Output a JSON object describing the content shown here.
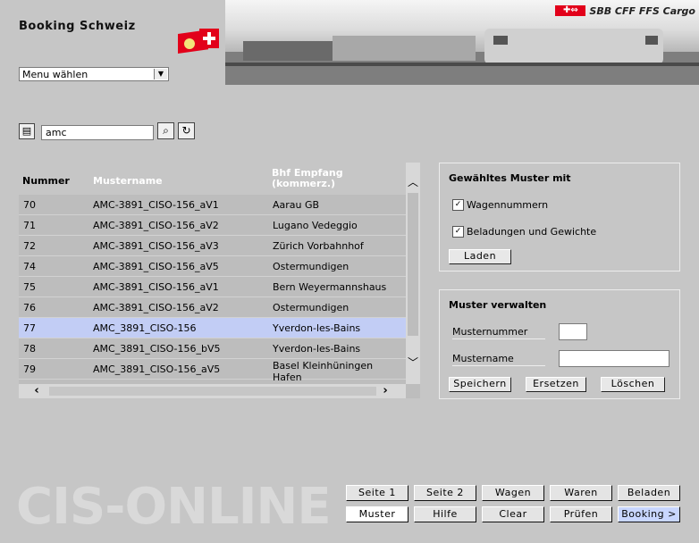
{
  "app": {
    "title": "Booking Schweiz"
  },
  "brand": {
    "mark": "✚⇔",
    "text": "SBB CFF FFS Cargo"
  },
  "menu": {
    "selected": "Menu wählen"
  },
  "search": {
    "value": "amc"
  },
  "table": {
    "headers": {
      "num": "Nummer",
      "name": "Mustername",
      "bhf_line1": "Bhf Empfang",
      "bhf_line2": "(kommerz.)"
    },
    "rows": [
      {
        "num": "70",
        "name": "AMC-3891_CISO-156_aV1",
        "bhf": "Aarau GB",
        "bhf2": ""
      },
      {
        "num": "71",
        "name": "AMC-3891_CISO-156_aV2",
        "bhf": "Lugano Vedeggio",
        "bhf2": ""
      },
      {
        "num": "72",
        "name": "AMC-3891_CISO-156_aV3",
        "bhf": "Zürich Vorbahnhof",
        "bhf2": ""
      },
      {
        "num": "74",
        "name": "AMC-3891_CISO-156_aV5",
        "bhf": "Ostermundigen",
        "bhf2": ""
      },
      {
        "num": "75",
        "name": "AMC-3891_CISO-156_aV1",
        "bhf": "Bern Weyermannshaus",
        "bhf2": ""
      },
      {
        "num": "76",
        "name": "AMC-3891_CISO-156_aV2",
        "bhf": "Ostermundigen",
        "bhf2": ""
      },
      {
        "num": "77",
        "name": "AMC_3891_CISO-156",
        "bhf": "Yverdon-les-Bains",
        "bhf2": ""
      },
      {
        "num": "78",
        "name": "AMC_3891_CISO-156_bV5",
        "bhf": "Yverdon-les-Bains",
        "bhf2": ""
      },
      {
        "num": "79",
        "name": "AMC_3891_CISO-156_aV5",
        "bhf": "Basel Kleinhüningen",
        "bhf2": "Hafen"
      }
    ],
    "selected_index": 6
  },
  "muster_panel": {
    "title": "Gewähltes Muster mit",
    "cb1": "Wagennummern",
    "cb2": "Beladungen und Gewichte",
    "load_label": "Laden"
  },
  "verwalten_panel": {
    "title": "Muster verwalten",
    "num_label": "Musternummer",
    "name_label": "Mustername",
    "save": "Speichern",
    "replace": "Ersetzen",
    "delete": "Löschen"
  },
  "watermark": "CIS-ONLINE",
  "footer": {
    "row1": [
      "Seite 1",
      "Seite 2",
      "Wagen",
      "Waren",
      "Beladen"
    ],
    "row2": [
      "Muster",
      "Hilfe",
      "Clear",
      "Prüfen",
      "Booking >"
    ]
  }
}
